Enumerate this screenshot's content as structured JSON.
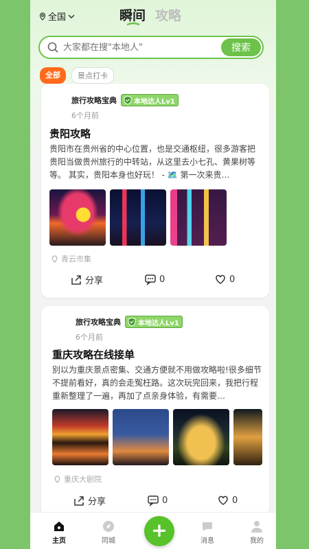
{
  "header": {
    "location": "全国",
    "tabs": [
      {
        "label": "瞬间",
        "active": true
      },
      {
        "label": "攻略",
        "active": false
      }
    ]
  },
  "search": {
    "placeholder": "大家都在搜\"本地人\"",
    "button": "搜索"
  },
  "filters": [
    {
      "label": "全部",
      "active": true
    },
    {
      "label": "景点打卡",
      "active": false
    }
  ],
  "posts": [
    {
      "author": "旅行攻略宝典",
      "badge": "本地达人Lv1",
      "time": "6个月前",
      "title": "贵阳攻略",
      "excerpt": "贵阳市在贵州省的中心位置，也是交通枢纽，很多游客把贵阳当做贵州旅行的中转站，从这里去小七孔、黄果树等等。 其实，贵阳本身也好玩！ - 🗺️ 第一次来贵…",
      "location": "青云市集",
      "share": "分享",
      "comments": "0",
      "likes": "0"
    },
    {
      "author": "旅行攻略宝典",
      "badge": "本地达人Lv1",
      "time": "6个月前",
      "title": "重庆攻略在线接单",
      "excerpt": "别以为重庆景点密集、交通方便就不用做攻略啦!很多细节不提前看好，真的会走冤枉路。这次玩完回来，我把行程重新整理了一遍，再加了点亲身体验，有需要…",
      "location": "重庆大剧院",
      "share": "分享",
      "comments": "0",
      "likes": "0"
    }
  ],
  "nav": {
    "home": "主页",
    "city": "同城",
    "messages": "消息",
    "mine": "我的",
    "add": "+"
  },
  "colors": {
    "brand_green": "#6cc24a",
    "accent_orange": "#ff6a1a",
    "outer_bg": "#7cc56a"
  }
}
